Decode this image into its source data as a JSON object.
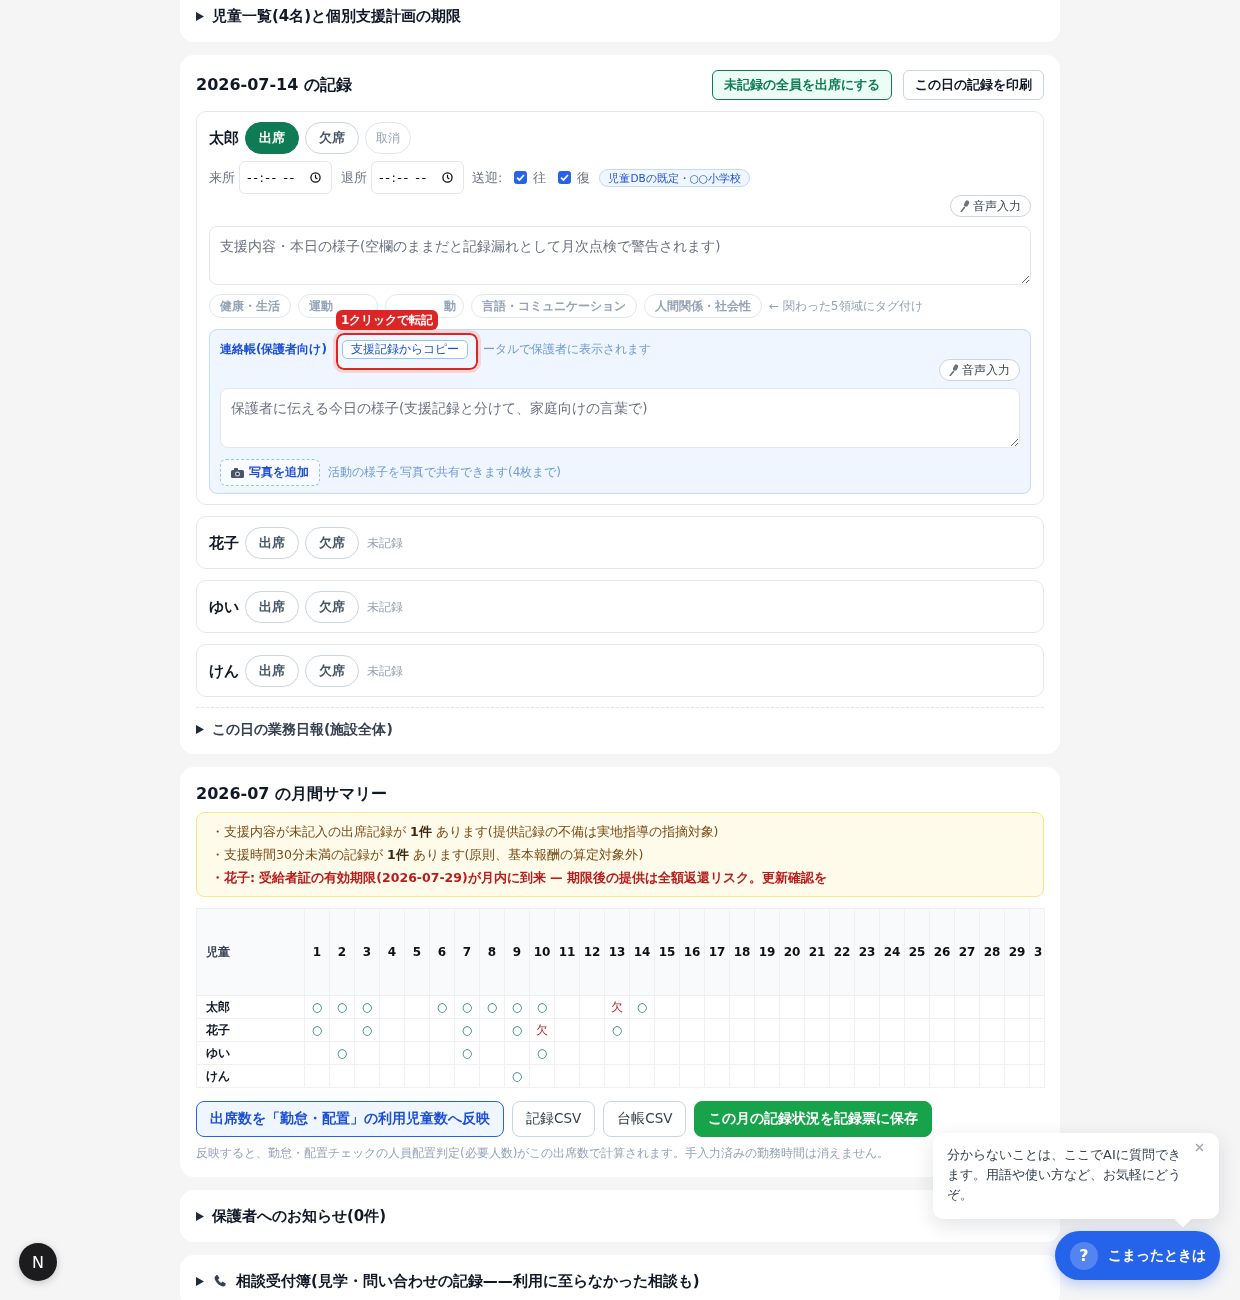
{
  "top_sections": [
    {
      "title": "児童一覧(4名)と個別支援計画の期限",
      "expanded": false
    }
  ],
  "daily": {
    "title": "2026-07-14 の記録",
    "actions": [
      {
        "label": "未記録の全員を出席にする",
        "kind": "accent"
      },
      {
        "label": "この日の記録を印刷",
        "kind": "plain"
      }
    ],
    "children": [
      {
        "name": "太郎",
        "attendance": [
          {
            "label": "出席",
            "selected": true
          },
          {
            "label": "欠席",
            "selected": false
          }
        ],
        "cancel": {
          "label": "取消",
          "disabled": true
        },
        "detail": {
          "arrival": {
            "label": "来所",
            "placeholder": "--:-- --"
          },
          "departure": {
            "label": "退所",
            "placeholder": "--:-- --"
          },
          "transport": {
            "label": "送迎:",
            "legs": [
              {
                "label": "往",
                "checked": true
              },
              {
                "label": "復",
                "checked": true
              }
            ],
            "default": "児童DBの既定・○○小学校"
          },
          "voice": "音声入力",
          "support": {
            "placeholder": "支援内容・本日の様子(空欄のままだと記録漏れとして月次点検で警告されます)"
          },
          "domains": [
            {
              "label": "健康・生活",
              "selected": false,
              "kind": "full"
            },
            {
              "label": "運動",
              "selected": false,
              "kind": "cut_end"
            },
            {
              "label": "動",
              "selected": false,
              "kind": "cut_start"
            },
            {
              "label": "言語・コミュニケーション",
              "selected": false,
              "kind": "full"
            },
            {
              "label": "人間関係・社会性",
              "selected": false,
              "kind": "full"
            }
          ],
          "domain_hint": "← 関わった5領域にタグ付け",
          "contact": {
            "title": "連絡帳(保護者向け)",
            "copy": {
              "label": "支援記録からコピー",
              "highlighted": true,
              "callout": "1クリックで転記"
            },
            "hint": "ータルで保護者に表示されます",
            "voice": "音声入力",
            "placeholder": "保護者に伝える今日の様子(支援記録と分けて、家庭向けの言葉で)",
            "photo": "写真を追加",
            "photo_hint": "活動の様子を写真で共有できます(4枚まで)"
          }
        }
      },
      {
        "name": "花子",
        "attendance": [
          {
            "label": "出席",
            "selected": false
          },
          {
            "label": "欠席",
            "selected": false
          }
        ],
        "note": "未記録"
      },
      {
        "name": "ゆい",
        "attendance": [
          {
            "label": "出席",
            "selected": false
          },
          {
            "label": "欠席",
            "selected": false
          }
        ],
        "note": "未記録"
      },
      {
        "name": "けん",
        "attendance": [
          {
            "label": "出席",
            "selected": false
          },
          {
            "label": "欠席",
            "selected": false
          }
        ],
        "note": "未記録"
      }
    ],
    "report": {
      "title": "この日の業務日報(施設全体)",
      "expanded": false
    }
  },
  "summary": {
    "title": "2026-07 の月間サマリー",
    "alerts": [
      {
        "text": "・支援内容が未記入の出席記録が **1件** あります(提供記録の不備は実地指導の指摘対象)",
        "kind": "warning"
      },
      {
        "text": "・支援時間30分未満の記録が **1件** あります(原則、基本報酬の算定対象外)",
        "kind": "warning"
      },
      {
        "text": "・花子: 受給者証の有効期限(2026-07-29)が月内に到来 — 期限後の提供は全額返還リスク。更新確認を",
        "kind": "danger"
      }
    ],
    "table": {
      "columns": [
        "児童",
        "1",
        "2",
        "3",
        "4",
        "5",
        "6",
        "7",
        "8",
        "9",
        "10",
        "11",
        "12",
        "13",
        "14",
        "15",
        "16",
        "17",
        "18",
        "19",
        "20",
        "21",
        "22",
        "23",
        "24",
        "25",
        "26",
        "27",
        "28",
        "29",
        "3"
      ],
      "rows": [
        {
          "cells": [
            {
              "text": "太郎",
              "kind": "name"
            },
            {
              "text": "○",
              "kind": "present"
            },
            {
              "text": "○",
              "kind": "present"
            },
            {
              "text": "○",
              "kind": "present"
            },
            null,
            null,
            {
              "text": "○",
              "kind": "present"
            },
            {
              "text": "○",
              "kind": "present"
            },
            {
              "text": "○",
              "kind": "present"
            },
            {
              "text": "○",
              "kind": "present"
            },
            {
              "text": "○",
              "kind": "present"
            },
            null,
            null,
            {
              "text": "欠",
              "kind": "absent"
            },
            {
              "text": "○",
              "kind": "present"
            },
            null,
            null,
            null,
            null,
            null,
            null,
            null,
            null,
            null,
            null,
            null,
            null,
            null,
            null,
            null,
            null
          ]
        },
        {
          "cells": [
            {
              "text": "花子",
              "kind": "name"
            },
            {
              "text": "○",
              "kind": "present"
            },
            null,
            {
              "text": "○",
              "kind": "present"
            },
            null,
            null,
            null,
            {
              "text": "○",
              "kind": "present"
            },
            null,
            {
              "text": "○",
              "kind": "present"
            },
            {
              "text": "欠",
              "kind": "absent"
            },
            null,
            null,
            {
              "text": "○",
              "kind": "present"
            },
            null,
            null,
            null,
            null,
            null,
            null,
            null,
            null,
            null,
            null,
            null,
            null,
            null,
            null,
            null,
            null,
            null
          ]
        },
        {
          "cells": [
            {
              "text": "ゆい",
              "kind": "name"
            },
            null,
            {
              "text": "○",
              "kind": "present"
            },
            null,
            null,
            null,
            null,
            {
              "text": "○",
              "kind": "present"
            },
            null,
            null,
            {
              "text": "○",
              "kind": "present"
            },
            null,
            null,
            null,
            null,
            null,
            null,
            null,
            null,
            null,
            null,
            null,
            null,
            null,
            null,
            null,
            null,
            null,
            null,
            null,
            null
          ]
        },
        {
          "cells": [
            {
              "text": "けん",
              "kind": "name"
            },
            null,
            null,
            null,
            null,
            null,
            null,
            null,
            null,
            {
              "text": "○",
              "kind": "present"
            },
            null,
            null,
            null,
            null,
            null,
            null,
            null,
            null,
            null,
            null,
            null,
            null,
            null,
            null,
            null,
            null,
            null,
            null,
            null,
            null,
            null
          ]
        }
      ]
    },
    "actions": [
      {
        "label": "出席数を「勤怠・配置」の利用児童数へ反映",
        "kind": "primary"
      },
      {
        "label": "記録CSV",
        "kind": "plain"
      },
      {
        "label": "台帳CSV",
        "kind": "plain"
      },
      {
        "label": "この月の記録状況を記録票に保存",
        "kind": "success"
      }
    ],
    "note": "反映すると、勤怠・配置チェックの人員配置判定(必要人数)がこの出席数で計算されます。手入力済みの勤務時間は消えません。"
  },
  "bottom_sections": [
    {
      "title": "保護者へのお知らせ(0件)",
      "expanded": false,
      "kind": "plain"
    },
    {
      "title": "相談受付簿(見学・問い合わせの記録——利用に至らなかった相談も)",
      "expanded": false,
      "kind": "inquiry"
    }
  ],
  "dev_indicator": {
    "label": "N"
  },
  "help": {
    "open": true,
    "message": "分からないことは、ここでAIに質問できます。用語や使い方など、お気軽にどうぞ。",
    "symbol": "?",
    "label": "こまったときは"
  }
}
